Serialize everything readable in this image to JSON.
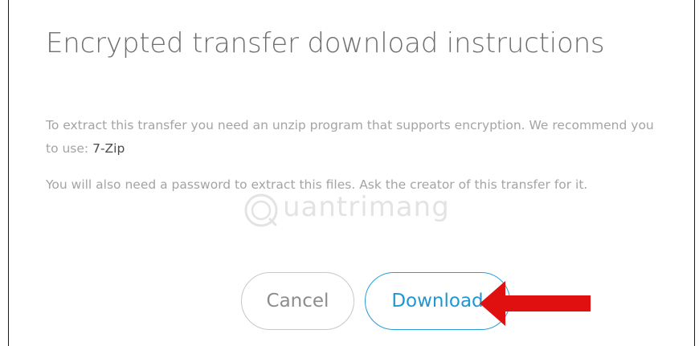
{
  "dialog": {
    "title": "Encrypted transfer download instructions",
    "paragraph1_text": "To extract this transfer you need an unzip program that supports encryption. We recommend you to use: ",
    "paragraph1_link": "7-Zip",
    "paragraph2_text": "You will also need a password to extract this files. Ask the creator of this transfer for it."
  },
  "buttons": {
    "cancel_label": "Cancel",
    "download_label": "Download"
  },
  "watermark": {
    "text": "uantrimang"
  },
  "colors": {
    "accent": "#2196d3",
    "arrow": "#e01010",
    "title": "#6e6e6e",
    "body_text": "#a4a4a4"
  },
  "icons": {
    "annotation": "red-arrow-icon",
    "watermark": "watermark-logo-icon"
  }
}
